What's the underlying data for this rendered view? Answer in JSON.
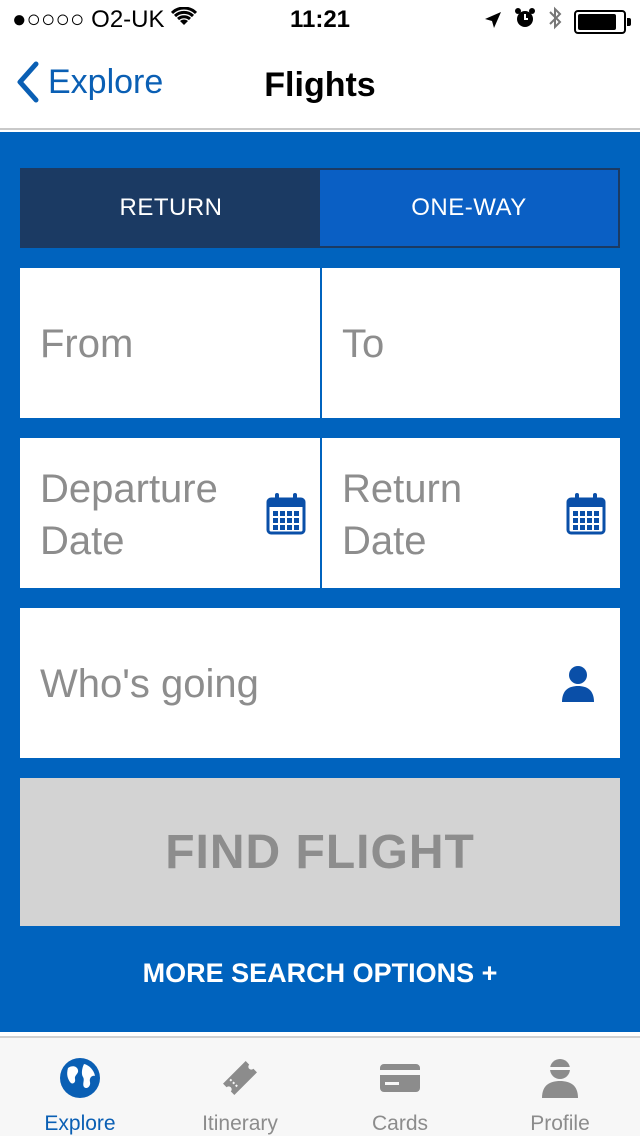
{
  "status_bar": {
    "carrier": "●○○○○ O2-UK",
    "time": "11:21",
    "icons": [
      "wifi-icon",
      "location-arrow-icon",
      "alarm-icon",
      "bluetooth-icon",
      "battery-icon"
    ]
  },
  "nav": {
    "back_label": "Explore",
    "title": "Flights"
  },
  "trip_type": {
    "return_label": "RETURN",
    "one_way_label": "ONE-WAY",
    "selected": "RETURN"
  },
  "form": {
    "from_placeholder": "From",
    "to_placeholder": "To",
    "departure_placeholder": "Departure\nDate",
    "return_placeholder": "Return\nDate",
    "passengers_placeholder": "Who's going"
  },
  "actions": {
    "find_label": "FIND FLIGHT",
    "more_options_label": "MORE SEARCH OPTIONS +"
  },
  "tabs": [
    {
      "label": "Explore",
      "icon": "globe-icon",
      "active": true
    },
    {
      "label": "Itinerary",
      "icon": "ticket-icon",
      "active": false
    },
    {
      "label": "Cards",
      "icon": "card-icon",
      "active": false
    },
    {
      "label": "Profile",
      "icon": "person-icon",
      "active": false
    }
  ],
  "colors": {
    "panel_blue": "#0063be",
    "toggle_active": "#1b3a63",
    "accent": "#0a5fb4",
    "disabled_button": "#d3d3d3"
  }
}
